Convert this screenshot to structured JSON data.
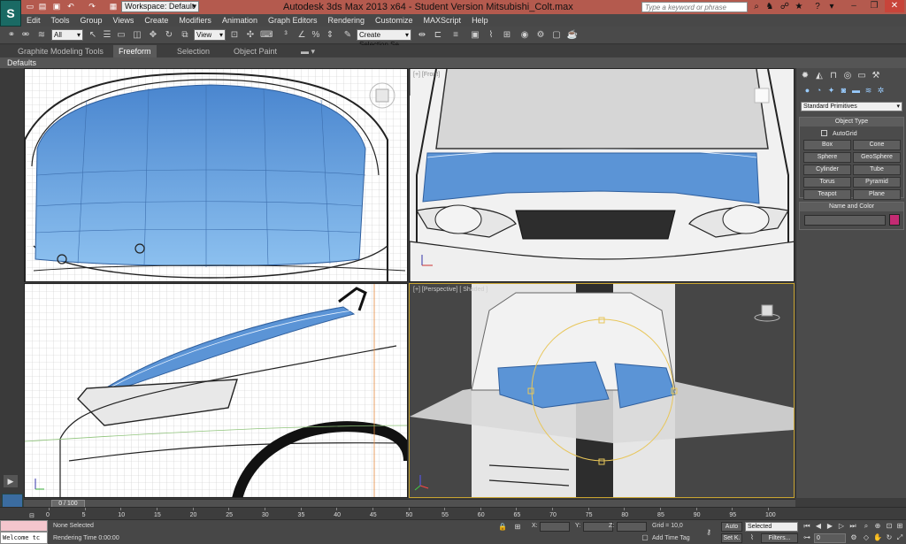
{
  "title_bar": {
    "app_title": "Autodesk 3ds Max  2013 x64   -  Student Version    Mitsubishi_Colt.max",
    "workspace_label": "Workspace: Default",
    "search_placeholder": "Type a keyword or phrase"
  },
  "menu": {
    "items": [
      "Edit",
      "Tools",
      "Group",
      "Views",
      "Create",
      "Modifiers",
      "Animation",
      "Graph Editors",
      "Rendering",
      "Customize",
      "MAXScript",
      "Help"
    ]
  },
  "toolbar": {
    "selection_filter": "All",
    "reference_coord": "View",
    "named_selection": "Create Selection Se"
  },
  "ribbon": {
    "tabs": [
      "Graphite Modeling Tools",
      "Freeform",
      "Selection",
      "Object Paint"
    ],
    "active_tab": "Freeform",
    "defaults_label": "Defaults"
  },
  "viewports": {
    "front_label": "[+] [Front]",
    "perspective_label": "[+] [Perspective] [ Shaded ]"
  },
  "command_panel": {
    "category": "Standard Primitives",
    "object_type_title": "Object Type",
    "autogrid_label": "AutoGrid",
    "primitives": [
      "Box",
      "Cone",
      "Sphere",
      "GeoSphere",
      "Cylinder",
      "Tube",
      "Torus",
      "Pyramid",
      "Teapot",
      "Plane"
    ],
    "name_color_title": "Name and Color",
    "object_color": "#c42b73"
  },
  "timeline": {
    "frame_display": "0 / 100",
    "ticks": [
      "0",
      "5",
      "10",
      "15",
      "20",
      "25",
      "30",
      "35",
      "40",
      "45",
      "50",
      "55",
      "60",
      "65",
      "70",
      "75",
      "80",
      "85",
      "90",
      "95",
      "100"
    ]
  },
  "status": {
    "listener_text": "Welcome tc",
    "selection_status": "None Selected",
    "prompt": "Rendering Time  0:00:00",
    "x_label": "X:",
    "y_label": "Y:",
    "z_label": "Z:",
    "grid": "Grid = 10,0",
    "add_time_tag": "Add Time Tag",
    "auto_key": "Auto",
    "set_key": "Set K.",
    "key_filter_value": "Selected",
    "filters_label": "Filters...",
    "frame_value": "0"
  },
  "colors": {
    "title_bar": "#b45a4e",
    "hood_blue": "#5b94d6",
    "active_viewport_border": "#c9a430"
  }
}
